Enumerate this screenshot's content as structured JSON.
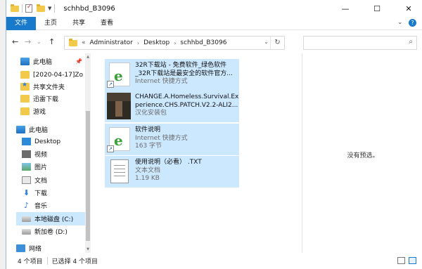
{
  "window": {
    "title": "schhbd_B3096",
    "controls": {
      "minimize": "—",
      "maximize": "☐",
      "close": "✕"
    }
  },
  "ribbon": {
    "tabs": [
      "文件",
      "主页",
      "共享",
      "查看"
    ],
    "expand_glyph": "⌄",
    "help_glyph": "?"
  },
  "address": {
    "back": "←",
    "forward": "→",
    "recent": "⌄",
    "up": "↑",
    "overflow": "«",
    "segments": [
      "Administrator",
      "Desktop",
      "schhbd_B3096"
    ],
    "separator": "›",
    "dropdown": "⌄",
    "refresh": "↻",
    "search_placeholder": "",
    "search_icon": "search-icon"
  },
  "nav": {
    "items": [
      {
        "label": "此电脑",
        "icon": "computer-icon",
        "pinned": true
      },
      {
        "label": "[2020-04-17]Zo",
        "icon": "folder-icon",
        "pinned": false
      },
      {
        "label": "共享文件夹",
        "icon": "shared-folder-icon",
        "pinned": false
      },
      {
        "label": "迅雷下载",
        "icon": "folder-icon",
        "pinned": false
      },
      {
        "label": "游戏",
        "icon": "folder-icon",
        "pinned": false
      },
      {
        "label": "此电脑",
        "icon": "computer-icon",
        "pinned": false
      },
      {
        "label": "Desktop",
        "icon": "desktop-icon",
        "pinned": false
      },
      {
        "label": "视频",
        "icon": "video-icon",
        "pinned": false
      },
      {
        "label": "图片",
        "icon": "pictures-icon",
        "pinned": false
      },
      {
        "label": "文档",
        "icon": "documents-icon",
        "pinned": false
      },
      {
        "label": "下载",
        "icon": "download-icon",
        "pinned": false
      },
      {
        "label": "音乐",
        "icon": "music-icon",
        "pinned": false
      },
      {
        "label": "本地磁盘 (C:)",
        "icon": "drive-icon",
        "pinned": false,
        "selected": true
      },
      {
        "label": "新加卷 (D:)",
        "icon": "drive-icon",
        "pinned": false
      },
      {
        "label": "网络",
        "icon": "network-icon",
        "pinned": false
      }
    ]
  },
  "files": [
    {
      "name_line1": "32R下载站 - 免费软件_绿色软件",
      "name_line2": "_32R下载站是最安全的软件官方...",
      "sub": "Internet 快捷方式",
      "icon": "internet-shortcut-icon"
    },
    {
      "name_line1": "CHANGE.A.Homeless.Survival.Ex",
      "name_line2": "perience.CHS.PATCH.V2.2-ALI2...",
      "sub": "汉化安装包",
      "icon": "installer-package-icon"
    },
    {
      "name_line1": "软件说明",
      "name_line2": "Internet 快捷方式",
      "sub": "163 字节",
      "icon": "internet-shortcut-icon"
    },
    {
      "name_line1": "使用说明（必看） .TXT",
      "name_line2": "文本文档",
      "sub": "1.19 KB",
      "icon": "text-file-icon"
    }
  ],
  "preview": {
    "empty_text": "没有预选。"
  },
  "status": {
    "item_count": "4 个项目",
    "selected_count": "已选择 4 个项目"
  },
  "colors": {
    "accent": "#1979ca",
    "selection": "#cce8ff"
  }
}
